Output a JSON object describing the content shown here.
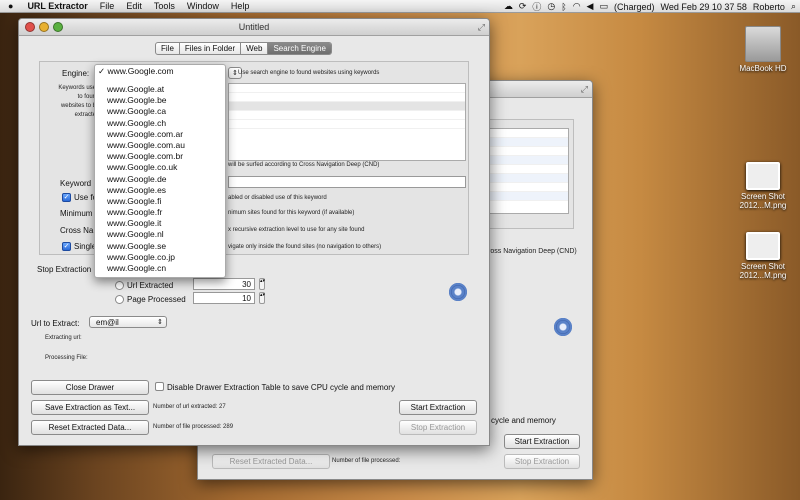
{
  "menubar": {
    "app": "URL Extractor",
    "items": [
      "File",
      "Edit",
      "Tools",
      "Window",
      "Help"
    ],
    "charge": "(Charged)",
    "clock": "Wed Feb 29  10 37 58",
    "user": "Roberto"
  },
  "desktop": {
    "icons": [
      {
        "label": "MacBook HD"
      },
      {
        "label": "Screen Shot\n2012...M.png"
      },
      {
        "label": "Screen Shot\n2012...M.png"
      }
    ]
  },
  "back_window": {
    "table_caption": "Cross Navigation Deep (CND)",
    "check_label": "cycle and memory",
    "start_label": "Start Extraction",
    "reset_label": "Reset Extracted Data...",
    "files_processed": "Number of file processed:",
    "stop_label": "Stop Extraction"
  },
  "main": {
    "title": "Untitled",
    "tabs": [
      "File",
      "Files in Folder",
      "Web",
      "Search Engine"
    ],
    "engine_label": "Engine:",
    "engine_hint": "Use search engine to found websites using keywords",
    "keywords_label": "Keywords use\nto foun\nwebsites to b\nextracte",
    "cnd_hint": "will be surfed according to Cross Navigation Deep (CND)",
    "keyword_label": "Keyword",
    "use_label": "Use fo",
    "use_hint": "abled or disabled use of this keyword",
    "minimum_label": "Minimum",
    "minimum_hint": "nimum sites found  for this keyword (if available)",
    "cross_label": "Cross Na",
    "cross_hint": "x recursive extraction level to use for any site found",
    "single_label": "Single",
    "single_hint": "vigate only inside the found sites (no navigation to others)",
    "stop_label": "Stop Extraction",
    "url_extracted_label": "Url Extracted",
    "url_extracted_value": "30",
    "page_processed_label": "Page Processed",
    "page_processed_value": "10",
    "url_to_extract_label": "Url to Extract:",
    "url_to_extract_value": "em@il",
    "extracting_label": "Extracting url:",
    "processing_label": "Processing File:",
    "close_drawer": "Close Drawer",
    "disable_drawer": "Disable Drawer Extraction Table to save CPU cycle and memory",
    "save_extraction": "Save Extraction as Text...",
    "url_count": "Number of url extracted: 27",
    "start_extraction": "Start Extraction",
    "reset_extracted": "Reset Extracted Data...",
    "file_count": "Number of file processed: 289",
    "stop_extraction": "Stop Extraction"
  },
  "dropdown": {
    "selected": "✓ www.Google.com",
    "options": [
      "www.Google.at",
      "www.Google.be",
      "www.Google.ca",
      "www.Google.ch",
      "www.Google.com.ar",
      "www.Google.com.au",
      "www.Google.com.br",
      "www.Google.co.uk",
      "www.Google.de",
      "www.Google.es",
      "www.Google.fi",
      "www.Google.fr",
      "www.Google.it",
      "www.Google.nl",
      "www.Google.se",
      "www.Google.co.jp",
      "www.Google.cn"
    ]
  }
}
